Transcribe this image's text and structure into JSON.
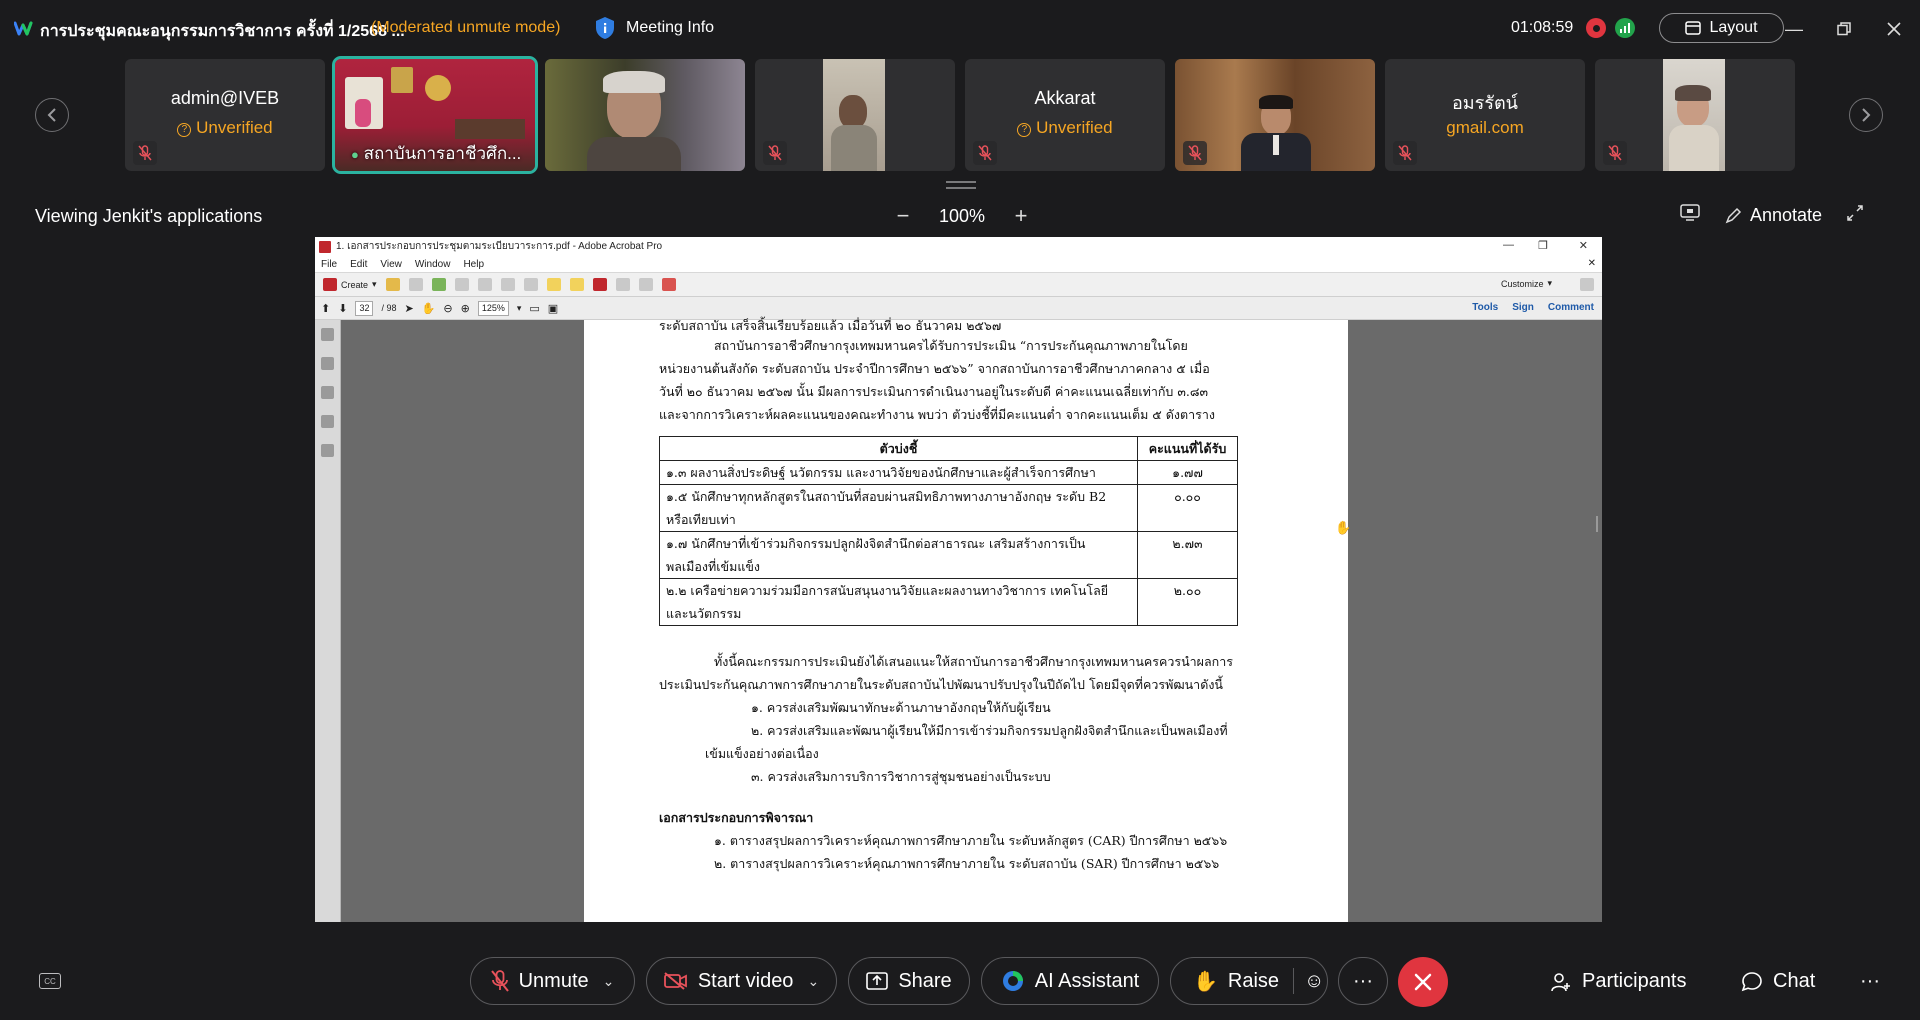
{
  "meeting": {
    "title": "การประชุมคณะอนุกรรมการวิชาการ ครั้งที่ 1/2568 ...",
    "mode": "(Moderated unmute mode)",
    "info_label": "Meeting Info",
    "timer": "01:08:59",
    "layout_label": "Layout"
  },
  "colors": {
    "accent_orange": "#f6a623",
    "record_red": "#e0353f",
    "signal_green": "#22a34b",
    "active_teal": "#2bb3a0",
    "background": "#1b1b1d",
    "tile": "#2f2f31"
  },
  "participants": [
    {
      "name": "admin@IVEB",
      "sub": "Unverified",
      "type": "avatar",
      "muted": true
    },
    {
      "label": "สถาบันการอาชีวศึก...",
      "type": "video-room",
      "muted": false,
      "active": true
    },
    {
      "type": "video-person",
      "muted": false
    },
    {
      "type": "video-person-small",
      "muted": true
    },
    {
      "name": "Akkarat",
      "sub": "Unverified",
      "type": "avatar",
      "muted": true
    },
    {
      "type": "video-office",
      "muted": true
    },
    {
      "name": "อมรรัตน์",
      "sub": "gmail.com",
      "type": "avatar",
      "muted": true
    },
    {
      "type": "video-person-small",
      "muted": true
    }
  ],
  "share": {
    "viewing": "Viewing Jenkit's applications",
    "zoom": "100%",
    "annotate": "Annotate"
  },
  "acrobat": {
    "title": "1. เอกสารประกอบการประชุมตามระเบียบวาระการ.pdf - Adobe Acrobat Pro",
    "menu": [
      "File",
      "Edit",
      "View",
      "Window",
      "Help"
    ],
    "create": "Create",
    "customize": "Customize",
    "page_current": "32",
    "page_total": "/ 98",
    "zoom": "125%",
    "links": [
      "Tools",
      "Sign",
      "Comment"
    ]
  },
  "document": {
    "line0": "ระดับสถาบัน เสร็จสิ้นเรียบร้อยแล้ว เมื่อวันที่ ๒๐ ธันวาคม ๒๕๖๗",
    "para1": [
      "สถาบันการอาชีวศึกษากรุงเทพมหานครได้รับการประเมิน “การประกันคุณภาพภายในโดย",
      "หน่วยงานต้นสังกัด ระดับสถาบัน ประจำปีการศึกษา ๒๕๖๖” จากสถาบันการอาชีวศึกษาภาคกลาง ๕ เมื่อ",
      "วันที่ ๒๐ ธันวาคม ๒๕๖๗ นั้น มีผลการประเมินการดำเนินงานอยู่ในระดับดี ค่าคะแนนเฉลี่ยเท่ากับ ๓.๘๓",
      "และจากการวิเคราะห์ผลคะแนนของคณะทำงาน พบว่า ตัวบ่งชี้ที่มีคะแนนต่ำ จากคะแนนเต็ม ๕ ดังตาราง"
    ],
    "table": {
      "headers": [
        "ตัวบ่งชี้",
        "คะแนนที่ได้รับ"
      ],
      "rows": [
        {
          "l1": "๑.๓  ผลงานสิ่งประดิษฐ์  นวัตกรรม  และงานวิจัยของนักศึกษาและผู้สำเร็จการศึกษา",
          "l2": "",
          "score": "๑.๗๗"
        },
        {
          "l1": "๑.๕ นักศึกษาทุกหลักสูตรในสถาบันที่สอบผ่านสมิทธิภาพทางภาษาอังกฤษ ระดับ B2",
          "l2": "หรือเทียบเท่า",
          "score": "๐.๐๐"
        },
        {
          "l1": "๑.๗  นักศึกษาที่เข้าร่วมกิจกรรมปลูกฝังจิตสำนึกต่อสาธารณะ  เสริมสร้างการเป็น",
          "l2": "พลเมืองที่เข้มแข็ง",
          "score": "๒.๗๓"
        },
        {
          "l1": "๒.๒  เครือข่ายความร่วมมือการสนับสนุนงานวิจัยและผลงานทางวิชาการ  เทคโนโลยี",
          "l2": "และนวัตกรรม",
          "score": "๒.๐๐"
        }
      ]
    },
    "para2": [
      "ทั้งนี้คณะกรรมการประเมินยังได้เสนอแนะให้สถาบันการอาชีวศึกษากรุงเทพมหานครควรนำผลการ",
      "ประเมินประกันคุณภาพการศึกษาภายในระดับสถาบันไปพัฒนาปรับปรุงในปีถัดไป  โดยมีจุดที่ควรพัฒนาดังนี้"
    ],
    "rec1": "๑.  ควรส่งเสริมพัฒนาทักษะด้านภาษาอังกฤษให้กับผู้เรียน",
    "rec2a": "๒.  ควรส่งเสริมและพัฒนาผู้เรียนให้มีการเข้าร่วมกิจกรรมปลูกฝังจิตสำนึกและเป็นพลเมืองที่",
    "rec2b": "เข้มแข็งอย่างต่อเนื่อง",
    "rec3": "๓.  ควรส่งเสริมการบริการวิชาการสู่ชุมชนอย่างเป็นระบบ",
    "section": "เอกสารประกอบการพิจารณา",
    "doc1": "๑. ตารางสรุปผลการวิเคราะห์คุณภาพการศึกษาภายใน ระดับหลักสูตร (CAR) ปีการศึกษา ๒๕๖๖",
    "doc2": "๒. ตารางสรุปผลการวิเคราะห์คุณภาพการศึกษาภายใน ระดับสถาบัน (SAR) ปีการศึกษา ๒๕๖๖"
  },
  "controls": {
    "unmute": "Unmute",
    "start_video": "Start video",
    "share": "Share",
    "ai_assistant": "AI Assistant",
    "raise": "Raise",
    "more": "···",
    "participants": "Participants",
    "chat": "Chat",
    "overflow": "···"
  }
}
